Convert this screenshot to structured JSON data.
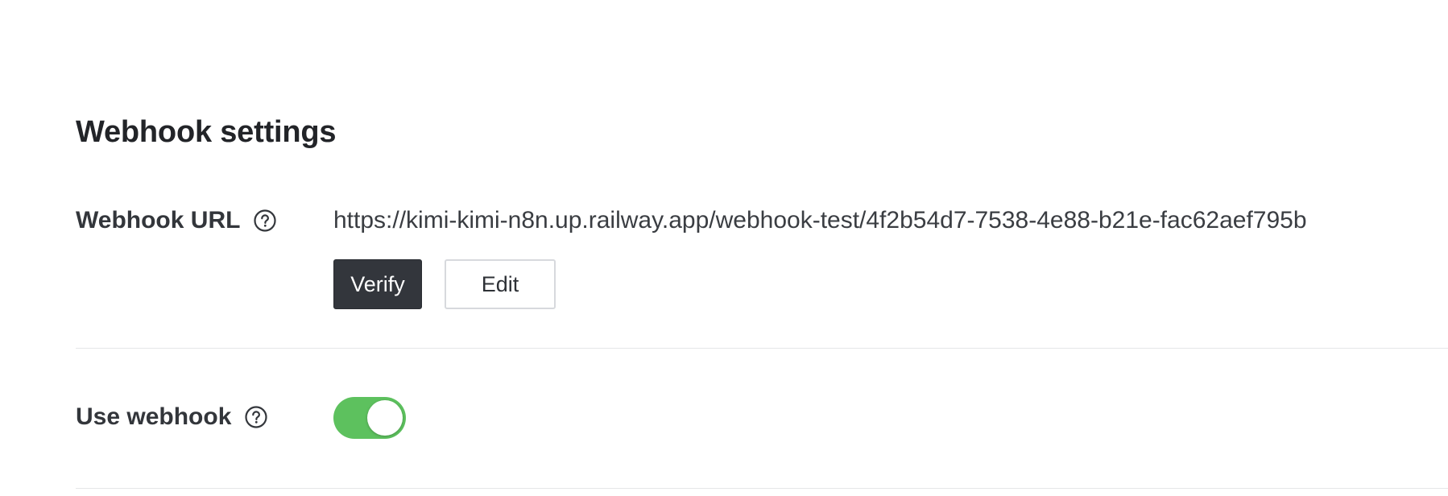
{
  "section": {
    "title": "Webhook settings"
  },
  "webhook_url": {
    "label": "Webhook URL",
    "value": "https://kimi-kimi-n8n.up.railway.app/webhook-test/4f2b54d7-7538-4e88-b21e-fac62aef795b",
    "verify_label": "Verify",
    "edit_label": "Edit"
  },
  "use_webhook": {
    "label": "Use webhook",
    "enabled": true
  },
  "icons": {
    "help": "help-circle-icon"
  },
  "colors": {
    "toggle_on": "#5dc15e",
    "verify_bg": "#33363c"
  }
}
